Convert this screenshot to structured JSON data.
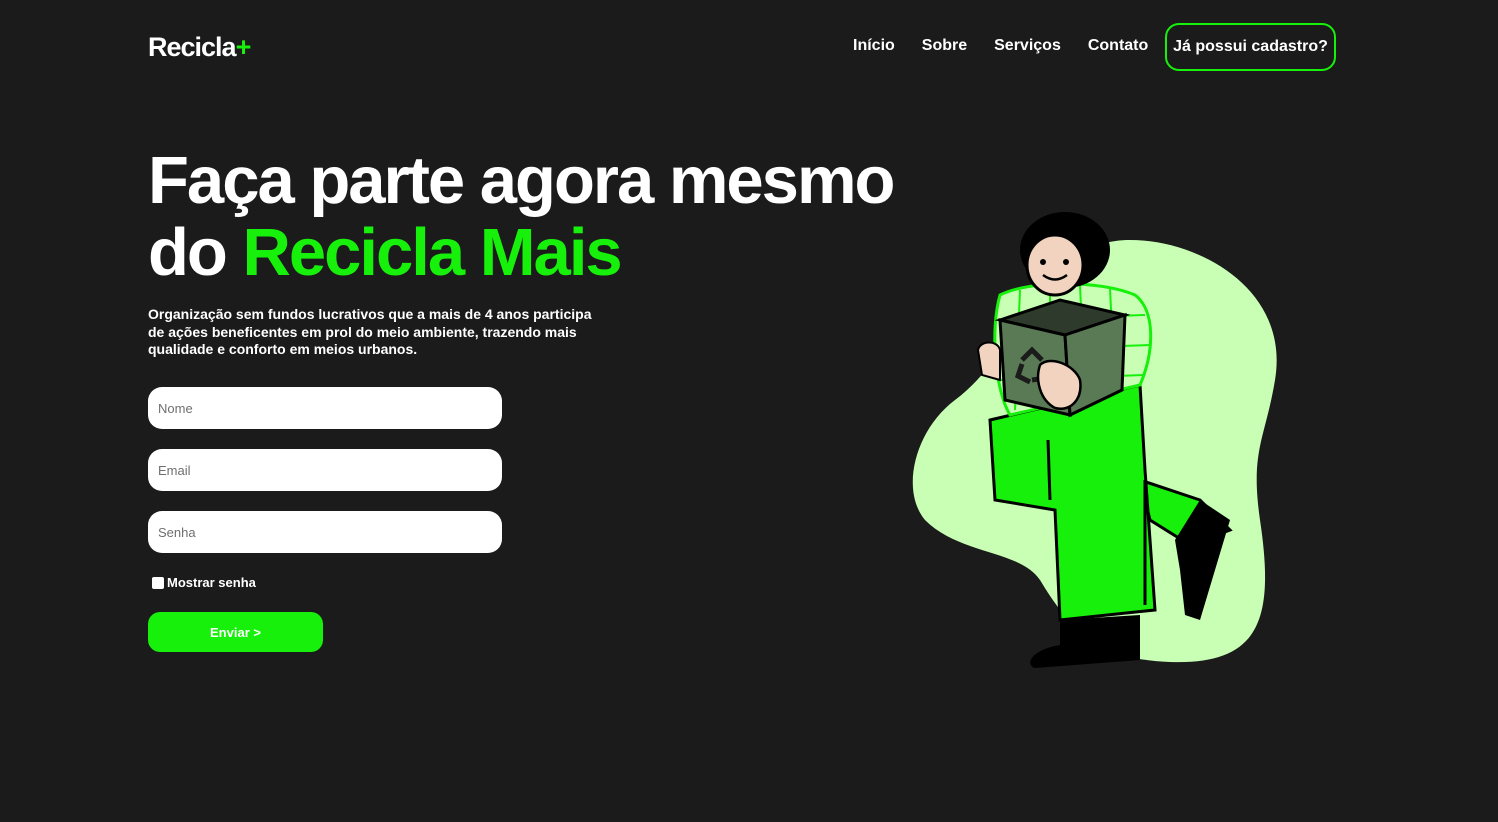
{
  "header": {
    "logo_text": "Recicla",
    "logo_plus": "+",
    "nav": [
      {
        "label": "Início"
      },
      {
        "label": "Sobre"
      },
      {
        "label": "Serviços"
      },
      {
        "label": "Contato"
      }
    ],
    "login_label": "Já possui cadastro?"
  },
  "hero": {
    "title_line1": "Faça parte agora mesmo",
    "title_line2_prefix": "do ",
    "title_line2_accent": "Recicla Mais",
    "description": "Organização sem fundos lucrativos que a mais de 4 anos participa de ações beneficentes em prol do meio ambiente, trazendo mais qualidade e conforto em meios urbanos."
  },
  "form": {
    "name_placeholder": "Nome",
    "email_placeholder": "Email",
    "password_placeholder": "Senha",
    "show_password_label": "Mostrar senha",
    "show_password_checked": false,
    "submit_label": "Enviar >"
  },
  "illustration": {
    "subject": "person-holding-recycle-box-icon"
  },
  "colors": {
    "background": "#1b1b1b",
    "accent": "#16f00a",
    "light_green": "#c8ffb4",
    "white": "#ffffff"
  }
}
